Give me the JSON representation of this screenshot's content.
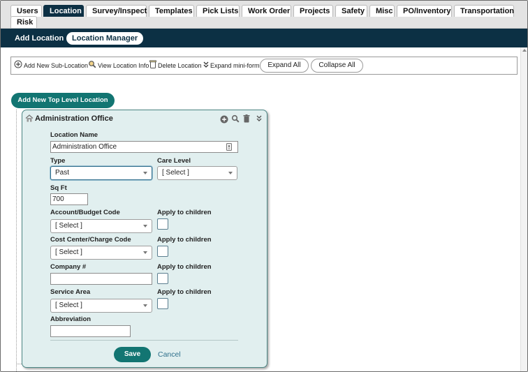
{
  "tabs": [
    {
      "label": "Users",
      "active": false
    },
    {
      "label": "Location",
      "active": true
    },
    {
      "label": "Survey/Inspect",
      "active": false
    },
    {
      "label": "Templates",
      "active": false
    },
    {
      "label": "Pick Lists",
      "active": false
    },
    {
      "label": "Work Order",
      "active": false
    },
    {
      "label": "Projects",
      "active": false
    },
    {
      "label": "Safety",
      "active": false
    },
    {
      "label": "Misc",
      "active": false
    },
    {
      "label": "PO/Inventory",
      "active": false
    },
    {
      "label": "Transportation",
      "active": false
    },
    {
      "label": "Risk",
      "active": false
    }
  ],
  "subnav": {
    "add_location": "Add Location",
    "location_manager": "Location Manager"
  },
  "toolbar": {
    "add_sub": "Add New Sub-Location",
    "view_info": "View Location Info",
    "delete": "Delete Location",
    "expand_mini": "Expand mini-form",
    "expand_all": "Expand All",
    "collapse_all": "Collapse All"
  },
  "add_top_level": "Add New Top Level Location",
  "card": {
    "title": "Administration Office",
    "location_name_label": "Location Name",
    "location_name_value": "Administration Office",
    "type_label": "Type",
    "type_value": "Past",
    "care_level_label": "Care Level",
    "care_level_value": "[ Select ]",
    "sqft_label": "Sq Ft",
    "sqft_value": "700",
    "account_label": "Account/Budget Code",
    "account_value": "[ Select ]",
    "apply1_label": "Apply to children",
    "cost_center_label": "Cost Center/Charge Code",
    "cost_center_value": "[ Select ]",
    "apply2_label": "Apply to children",
    "company_label": "Company #",
    "company_value": "",
    "apply3_label": "Apply to children",
    "service_area_label": "Service Area",
    "service_area_value": "[ Select ]",
    "apply4_label": "Apply to children",
    "abbreviation_label": "Abbreviation",
    "abbreviation_value": "",
    "save_label": "Save",
    "cancel_label": "Cancel"
  },
  "colors": {
    "navy": "#0c3044",
    "teal": "#127572",
    "card_bg": "#e1efef"
  },
  "icons": [
    "plus-circle-icon",
    "magnifier-icon",
    "trash-icon",
    "double-chevron-down-icon",
    "home-icon",
    "text-field-icon"
  ]
}
